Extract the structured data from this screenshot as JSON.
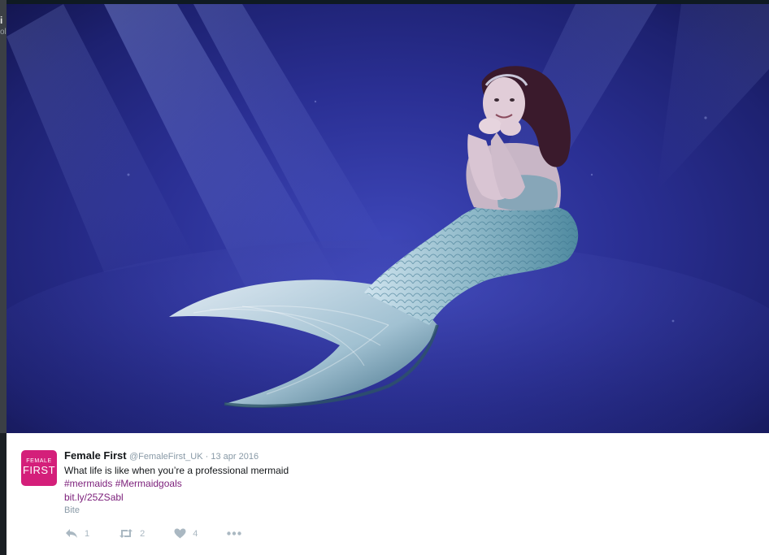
{
  "left_fragment": {
    "line1": "i",
    "line2": "ol"
  },
  "media": {
    "icon": "photo-mermaid-underwater"
  },
  "tweet": {
    "avatar": {
      "line1": "FEMALE",
      "line2": "FIRST",
      "color": "#d41f7a"
    },
    "author_name": "Female First",
    "author_handle": "@FemaleFirst_UK",
    "separator": " · ",
    "date": "13 apr 2016",
    "text": "What life is like when you’re a professional mermaid",
    "hashtags": [
      "#mermaids",
      "#Mermaidgoals"
    ],
    "link": "bit.ly/25ZSabl",
    "category": "Bite",
    "actions": {
      "reply_count": "1",
      "retweet_count": "2",
      "like_count": "4"
    },
    "link_color": "#7b1e7a"
  }
}
